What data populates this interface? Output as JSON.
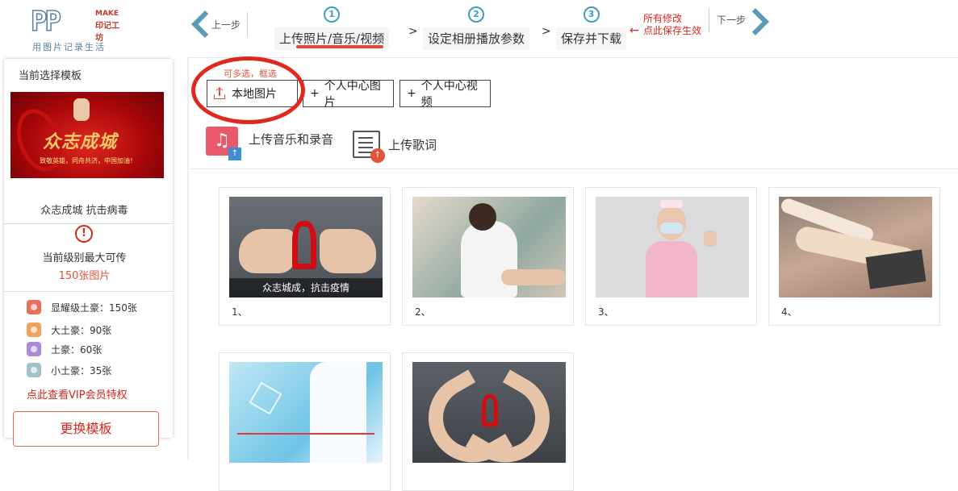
{
  "header": {
    "logo_letters": "PP",
    "logo_make": "MAKE",
    "logo_brand": "印记工坊",
    "logo_slogan": "用图片记录生活",
    "prev_label": "上一步",
    "next_label": "下一步",
    "steps": [
      {
        "num": "1",
        "label": "上传照片/音乐/视频",
        "active": true
      },
      {
        "num": "2",
        "label": "设定相册播放参数",
        "active": false
      },
      {
        "num": "3",
        "label": "保存并下载",
        "active": false
      }
    ],
    "step_separator": ">",
    "save_hint_line1": "所有修改",
    "save_hint_line2": "点此保存生效",
    "accent_color": "#3f9bc3",
    "warning_color": "#d9261c"
  },
  "sidebar": {
    "title": "当前选择模板",
    "template_name": "众志成城 抗击病毒",
    "thumb_title": "众志成城",
    "thumb_subtitle": "致敬英雄，同舟共济，中国加油！",
    "max_label": "当前级别最大可传",
    "max_value": "150张图片",
    "levels": [
      {
        "label": "显耀级土豪：150张",
        "color": "#e8705a"
      },
      {
        "label": "大土豪：90张",
        "color": "#f0a15c"
      },
      {
        "label": "土豪：60张",
        "color": "#a98bd8"
      },
      {
        "label": "小土豪：35张",
        "color": "#9fc3c9"
      }
    ],
    "vip_link": "点此查看VIP会员特权",
    "change_button": "更换模板"
  },
  "main": {
    "multi_hint": "可多选，框选",
    "buttons": {
      "local_images": "本地图片",
      "personal_images": "个人中心图片",
      "personal_videos": "个人中心视频"
    },
    "plus": "+",
    "upload_music": "上传音乐和录音",
    "upload_lyrics": "上传歌词",
    "photos": [
      {
        "index": "1、",
        "caption": "众志城成，抗击疫情"
      },
      {
        "index": "2、",
        "caption": ""
      },
      {
        "index": "3、",
        "caption": ""
      },
      {
        "index": "4、",
        "caption": ""
      },
      {
        "index": "",
        "caption": ""
      },
      {
        "index": "",
        "caption": ""
      }
    ]
  }
}
